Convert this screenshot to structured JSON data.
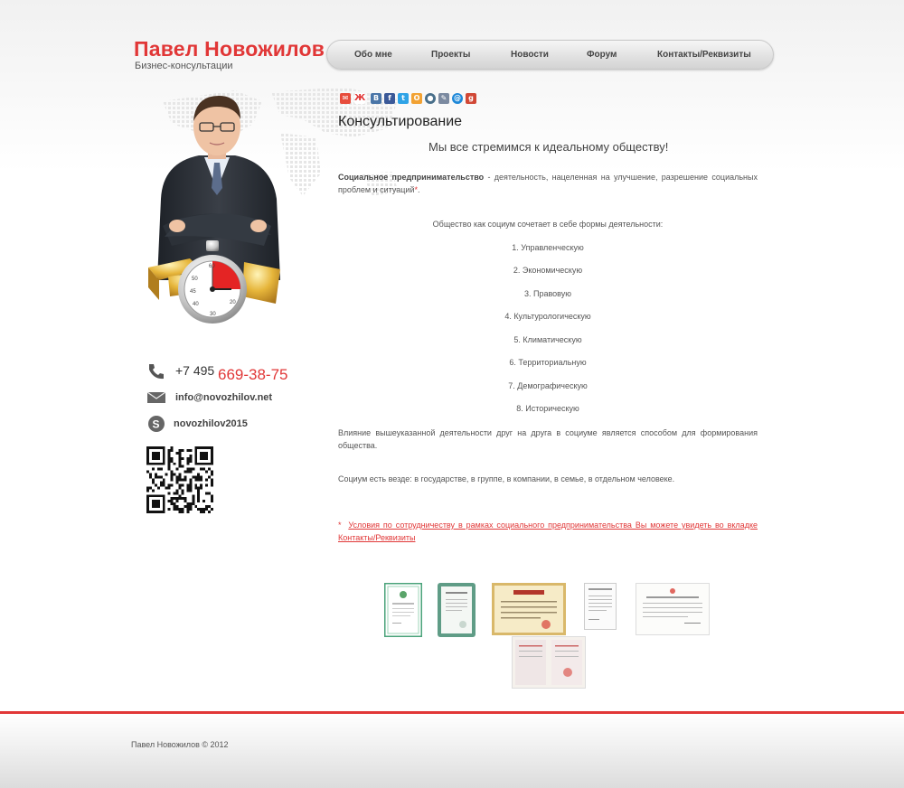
{
  "header": {
    "name": "Павел Новожилов",
    "subtitle": "Бизнес-консультации"
  },
  "nav": {
    "items": [
      {
        "label": "Обо мне"
      },
      {
        "label": "Проекты"
      },
      {
        "label": "Новости"
      },
      {
        "label": "Форум"
      },
      {
        "label": "Контакты/Реквизиты"
      }
    ]
  },
  "contacts": {
    "phone_prefix": "+7 495",
    "phone_number": "669-38-75",
    "email": "info@novozhilov.net",
    "skype": "novozhilov2015"
  },
  "social_icons": [
    "gmail-icon",
    "moikrug-icon",
    "vk-icon",
    "facebook-icon",
    "twitter-icon",
    "odnoklassniki-icon",
    "livejournal-icon",
    "delicious-icon",
    "mailru-icon",
    "googleplus-icon"
  ],
  "content": {
    "title": "Консультирование",
    "slogan": "Мы все стремимся к идеальному обществу!",
    "definition_term": "Социальное предпринимательство",
    "definition_text": " - деятельность, нацеленная на улучшение, разрешение социальных проблем и ситуаций",
    "definition_star": "*",
    "definition_end": ".",
    "intro": "Общество как социум сочетает в себе формы деятельности:",
    "list": [
      "1. Управленческую",
      "2. Экономическую",
      "3. Правовую",
      "4. Культурологическую",
      "5. Климатическую",
      "6. Территориальную",
      "7. Демографическую",
      "8. Историческую"
    ],
    "influence": "Влияние вышеуказанной деятельности друг на друга в социуме является способом для формирования общества.",
    "society": "Социум есть везде: в государстве, в группе, в компании, в семье, в отдельном человеке.",
    "note_star": "*",
    "note_link": "Условия по сотрудничеству в рамках социального предпринимательства Вы можете увидеть во вкладке Контакты/Реквизиты"
  },
  "certificates": 6,
  "footer": {
    "copyright": "Павел Новожилов © 2012"
  },
  "colors": {
    "accent": "#e13737",
    "text": "#555555"
  }
}
